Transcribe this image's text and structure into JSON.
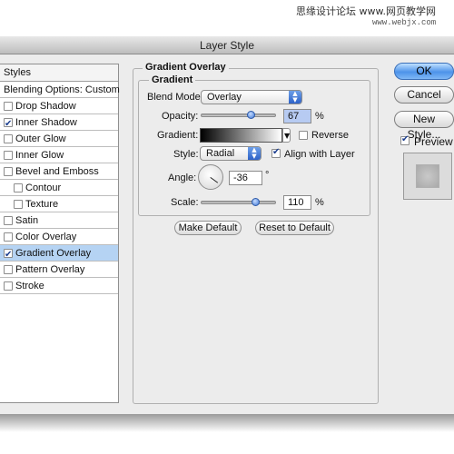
{
  "watermark": {
    "site": "思缘设计论坛  www.网页教学网",
    "url": "www.webjx.com"
  },
  "window": {
    "title": "Layer Style"
  },
  "styles_panel": {
    "header": "Styles",
    "items": [
      {
        "label": "Blending Options: Custom",
        "checkbox": false,
        "checked": false,
        "selected": false,
        "indent": false
      },
      {
        "label": "Drop Shadow",
        "checkbox": true,
        "checked": false,
        "selected": false,
        "indent": false
      },
      {
        "label": "Inner Shadow",
        "checkbox": true,
        "checked": true,
        "selected": false,
        "indent": false
      },
      {
        "label": "Outer Glow",
        "checkbox": true,
        "checked": false,
        "selected": false,
        "indent": false
      },
      {
        "label": "Inner Glow",
        "checkbox": true,
        "checked": false,
        "selected": false,
        "indent": false
      },
      {
        "label": "Bevel and Emboss",
        "checkbox": true,
        "checked": false,
        "selected": false,
        "indent": false
      },
      {
        "label": "Contour",
        "checkbox": true,
        "checked": false,
        "selected": false,
        "indent": true
      },
      {
        "label": "Texture",
        "checkbox": true,
        "checked": false,
        "selected": false,
        "indent": true
      },
      {
        "label": "Satin",
        "checkbox": true,
        "checked": false,
        "selected": false,
        "indent": false
      },
      {
        "label": "Color Overlay",
        "checkbox": true,
        "checked": false,
        "selected": false,
        "indent": false
      },
      {
        "label": "Gradient Overlay",
        "checkbox": true,
        "checked": true,
        "selected": true,
        "indent": false
      },
      {
        "label": "Pattern Overlay",
        "checkbox": true,
        "checked": false,
        "selected": false,
        "indent": false
      },
      {
        "label": "Stroke",
        "checkbox": true,
        "checked": false,
        "selected": false,
        "indent": false
      }
    ]
  },
  "gradient_overlay": {
    "section_title": "Gradient Overlay",
    "subsection_title": "Gradient",
    "blend_mode": {
      "label": "Blend Mode:",
      "value": "Overlay"
    },
    "opacity": {
      "label": "Opacity:",
      "value": "67",
      "unit": "%",
      "level": 0.67
    },
    "gradient": {
      "label": "Gradient:",
      "reverse_label": "Reverse",
      "reverse_checked": false
    },
    "style": {
      "label": "Style:",
      "value": "Radial",
      "align_label": "Align with Layer",
      "align_checked": true
    },
    "angle": {
      "label": "Angle:",
      "value": "-36",
      "unit": "°"
    },
    "scale": {
      "label": "Scale:",
      "value": "110",
      "unit": "%",
      "level": 0.73
    },
    "make_default": "Make Default",
    "reset_default": "Reset to Default"
  },
  "right_buttons": {
    "ok": "OK",
    "cancel": "Cancel",
    "new_style": "New Style...",
    "preview_label": "Preview",
    "preview_checked": true
  },
  "colors": {
    "selection": "#b5d3f3",
    "accent": "#3f78d6",
    "dialog_bg": "#ececec"
  }
}
